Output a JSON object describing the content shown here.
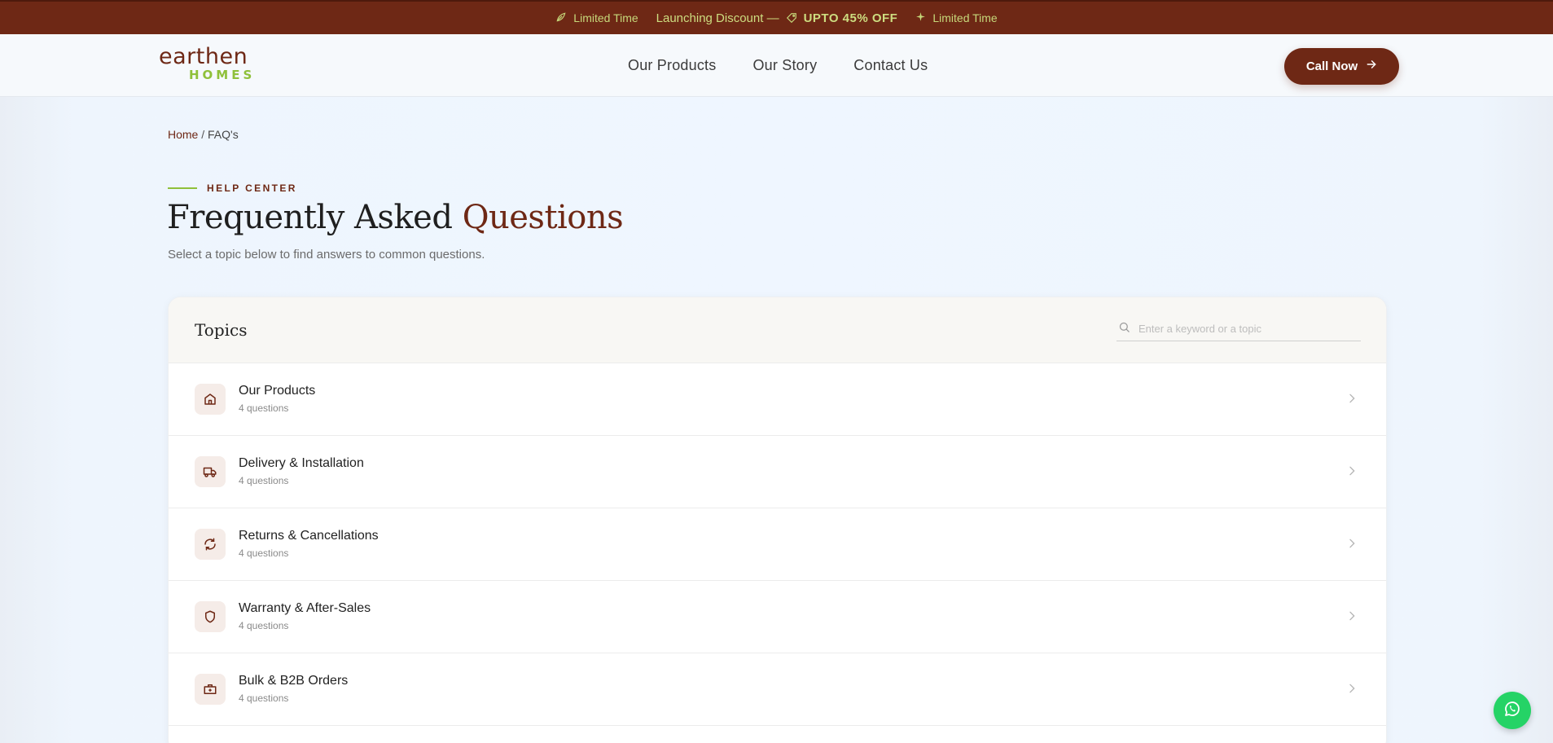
{
  "promo": {
    "left_label": "Limited Time",
    "discount_text": "Launching Discount —",
    "offer_text": "UPTO 45% OFF",
    "right_label": "Limited Time"
  },
  "logo": {
    "line1": "earthen",
    "line2": "HOMES"
  },
  "nav": {
    "items": [
      {
        "label": "Our Products"
      },
      {
        "label": "Our Story"
      },
      {
        "label": "Contact Us"
      }
    ],
    "cta_label": "Call Now"
  },
  "breadcrumb": {
    "home": "Home",
    "separator": "/",
    "current": "FAQ's"
  },
  "hero": {
    "eyebrow": "HELP CENTER",
    "title_plain": "Frequently Asked",
    "title_accent": "Questions",
    "subtitle": "Select a topic below to find answers to common questions."
  },
  "card": {
    "title": "Topics",
    "search_placeholder": "Enter a keyword or a topic",
    "topics": [
      {
        "name": "Our Products",
        "count": "4 questions",
        "icon": "home-icon"
      },
      {
        "name": "Delivery & Installation",
        "count": "4 questions",
        "icon": "truck-icon"
      },
      {
        "name": "Returns & Cancellations",
        "count": "4 questions",
        "icon": "refresh-icon"
      },
      {
        "name": "Warranty & After-Sales",
        "count": "4 questions",
        "icon": "shield-icon"
      },
      {
        "name": "Bulk & B2B Orders",
        "count": "4 questions",
        "icon": "briefcase-icon"
      }
    ]
  },
  "colors": {
    "brand": "#6e2815",
    "accent_green": "#8fc03a",
    "promo_text": "#c6d87a",
    "whatsapp": "#25d366"
  }
}
